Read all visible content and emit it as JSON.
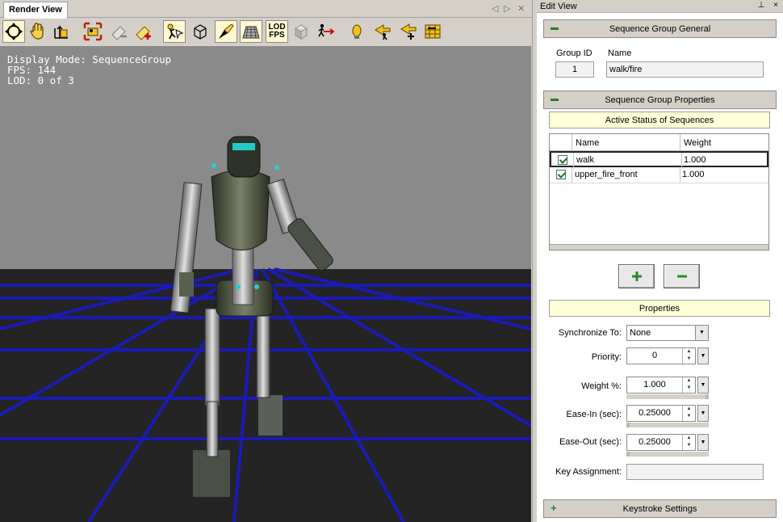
{
  "render_view": {
    "tab_label": "Render View",
    "nav_prev": "◁",
    "nav_next": "▷",
    "nav_close": "✕",
    "toolbar_icons": [
      "move-camera-icon",
      "pan-hand-icon",
      "rotate-arrow-icon",
      "zoom-extents-icon",
      "eraser-minus-icon",
      "eraser-plus-icon",
      "select-figure-icon",
      "wireframe-cube-icon",
      "spotlight-icon",
      "grid-icon",
      "lod-fps-icon",
      "shaded-cube-icon",
      "run-arrow-icon",
      "light-bulb-icon",
      "sequence-back-icon",
      "sequence-add-icon",
      "timeline-icon"
    ],
    "lod_line1": "LOD",
    "lod_line2": "FPS",
    "hud": {
      "display_mode": "Display Mode: SequenceGroup",
      "fps": "FPS: 144",
      "lod": "LOD: 0 of 3"
    }
  },
  "edit_view": {
    "title": "Edit View",
    "pin_glyph": "⊥",
    "close_glyph": "×",
    "general": {
      "header": "Sequence Group General",
      "group_id_label": "Group ID",
      "name_label": "Name",
      "group_id": "1",
      "name": "walk/fire"
    },
    "properties_section": {
      "header": "Sequence Group Properties",
      "active_status_title": "Active Status of Sequences",
      "columns": [
        "Name",
        "Weight"
      ],
      "rows": [
        {
          "name": "walk",
          "weight": "1.000",
          "checked": true
        },
        {
          "name": "upper_fire_front",
          "weight": "1.000",
          "checked": true
        }
      ],
      "add_glyph": "+",
      "remove_glyph": "−"
    },
    "properties": {
      "title": "Properties",
      "synchronize_label": "Synchronize To:",
      "synchronize_value": "None",
      "priority_label": "Priority:",
      "priority_value": "0",
      "weight_label": "Weight %:",
      "weight_value": "1.000",
      "ease_in_label": "Ease-In (sec):",
      "ease_in_value": "0.25000",
      "ease_out_label": "Ease-Out (sec):",
      "ease_out_value": "0.25000",
      "key_assignment_label": "Key Assignment:",
      "key_assignment_value": ""
    },
    "keystroke": {
      "header": "Keystroke Settings"
    }
  }
}
